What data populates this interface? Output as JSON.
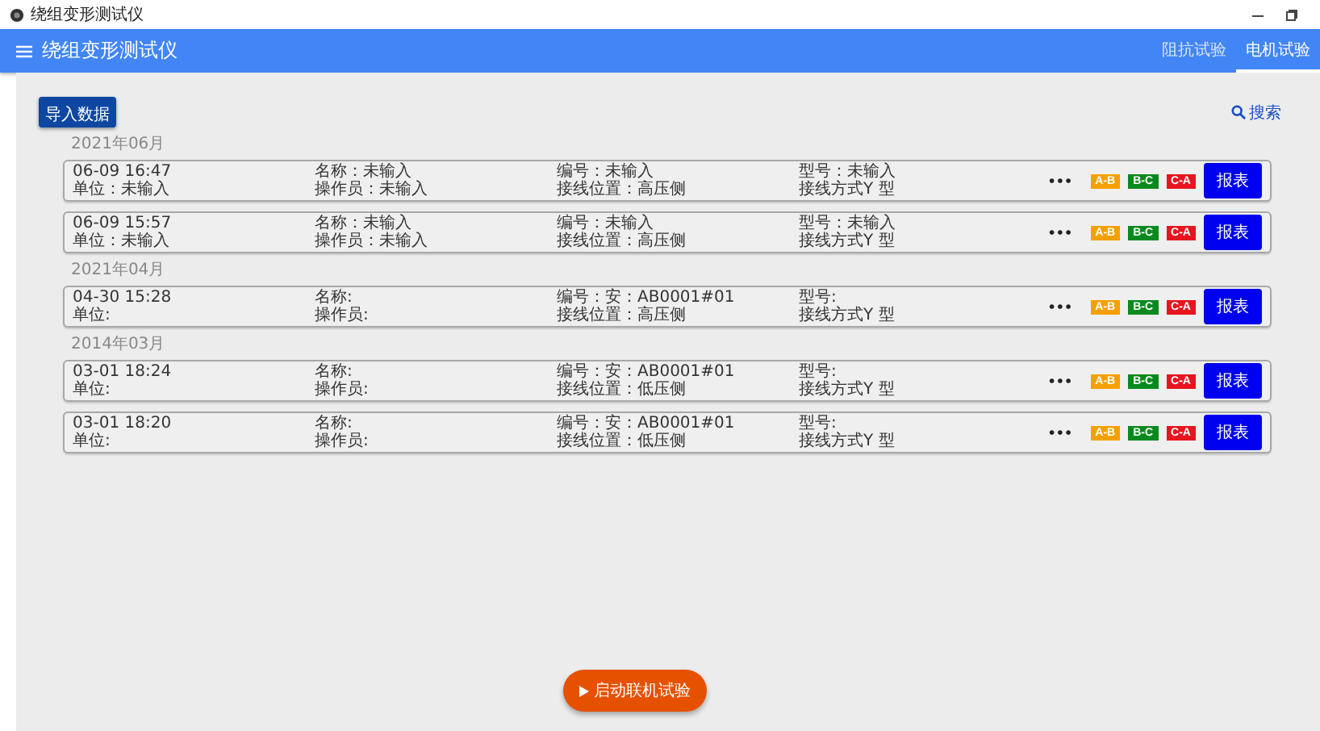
{
  "window": {
    "title": "绕组变形测试仪"
  },
  "app_bar": {
    "title": "绕组变形测试仪",
    "tabs": [
      {
        "label": "阻抗试验",
        "selected": false
      },
      {
        "label": "电机试验",
        "selected": true
      }
    ]
  },
  "import_button": "导入数据",
  "search": "搜索",
  "groups": [
    {
      "month": "2021年06月",
      "records": [
        {
          "time": "06-09 16:47",
          "unit": "单位：未输入",
          "name": "名称：未输入",
          "operator": "操作员：未输入",
          "code": "编号：未输入",
          "position": "接线位置：高压侧",
          "model": "型号：未输入",
          "wiring": "接线方式Y 型",
          "more": "•••",
          "tags": [
            {
              "label": "A-B",
              "color": "#f5a000"
            },
            {
              "label": "B-C",
              "color": "#0a8a1e"
            },
            {
              "label": "C-A",
              "color": "#e8141e"
            }
          ],
          "report": "报表"
        },
        {
          "time": "06-09 15:57",
          "unit": "单位：未输入",
          "name": "名称：未输入",
          "operator": "操作员：未输入",
          "code": "编号：未输入",
          "position": "接线位置：高压侧",
          "model": "型号：未输入",
          "wiring": "接线方式Y 型",
          "more": "•••",
          "tags": [
            {
              "label": "A-B",
              "color": "#f5a000"
            },
            {
              "label": "B-C",
              "color": "#0a8a1e"
            },
            {
              "label": "C-A",
              "color": "#e8141e"
            }
          ],
          "report": "报表"
        }
      ]
    },
    {
      "month": "2021年04月",
      "records": [
        {
          "time": "04-30 15:28",
          "unit": "单位:",
          "name": "名称:",
          "operator": "操作员:",
          "code": "编号：安：AB0001#01",
          "position": "接线位置：高压侧",
          "model": "型号:",
          "wiring": "接线方式Y 型",
          "more": "•••",
          "tags": [
            {
              "label": "A-B",
              "color": "#f5a000"
            },
            {
              "label": "B-C",
              "color": "#0a8a1e"
            },
            {
              "label": "C-A",
              "color": "#e8141e"
            }
          ],
          "report": "报表"
        }
      ]
    },
    {
      "month": "2014年03月",
      "records": [
        {
          "time": "03-01 18:24",
          "unit": "单位:",
          "name": "名称:",
          "operator": "操作员:",
          "code": "编号：安：AB0001#01",
          "position": "接线位置：低压侧",
          "model": "型号:",
          "wiring": "接线方式Y 型",
          "more": "•••",
          "tags": [
            {
              "label": "A-B",
              "color": "#f5a000"
            },
            {
              "label": "B-C",
              "color": "#0a8a1e"
            },
            {
              "label": "C-A",
              "color": "#e8141e"
            }
          ],
          "report": "报表"
        },
        {
          "time": "03-01 18:20",
          "unit": "单位:",
          "name": "名称:",
          "operator": "操作员:",
          "code": "编号：安：AB0001#01",
          "position": "接线位置：低压侧",
          "model": "型号:",
          "wiring": "接线方式Y 型",
          "more": "•••",
          "tags": [
            {
              "label": "A-B",
              "color": "#f5a000"
            },
            {
              "label": "B-C",
              "color": "#0a8a1e"
            },
            {
              "label": "C-A",
              "color": "#e8141e"
            }
          ],
          "report": "报表"
        }
      ]
    }
  ],
  "start_button": "启动联机试验"
}
